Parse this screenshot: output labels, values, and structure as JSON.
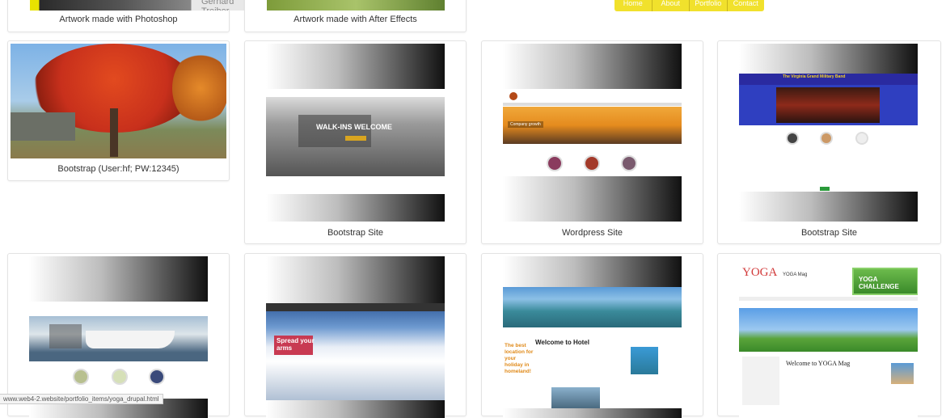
{
  "nav": {
    "items": [
      "Home",
      "About",
      "Portfolio",
      "Contact"
    ]
  },
  "status_url": "www.web4-2.website/portfolio_items/yoga_drupal.html",
  "top_cards": [
    {
      "caption": "Artwork made with Photoshop",
      "overlay_name": "Gerhard Treiber"
    },
    {
      "caption": "Artwork made with After Effects"
    }
  ],
  "cards": [
    {
      "caption": "Bootstrap (User:hf; PW:12345)"
    },
    {
      "caption": "Bootstrap Site",
      "thumb_text": "WALK-INS WELCOME"
    },
    {
      "caption": "Wordpress Site",
      "thumb_text": "Company growth"
    },
    {
      "caption": "Bootstrap Site",
      "thumb_title": "The Virginia Grand Military Band"
    }
  ],
  "bottom_cards": [
    {
      "name": "yacht"
    },
    {
      "thumb_text": "Spread your arms"
    },
    {
      "thumb_title": "Welcome to Hotel",
      "thumb_side": "The best location for your holiday in homeland!"
    },
    {
      "logo": "YOGA",
      "brand": "YOGA Mag",
      "banner": "YOGA CHALLENGE",
      "welcome": "Welcome to YOGA Mag"
    }
  ],
  "colors": {
    "nav_bg": "#f1e12c",
    "card_border": "#e3e3e3",
    "tree": "#c8301c",
    "sky": "#6ea7e0"
  }
}
